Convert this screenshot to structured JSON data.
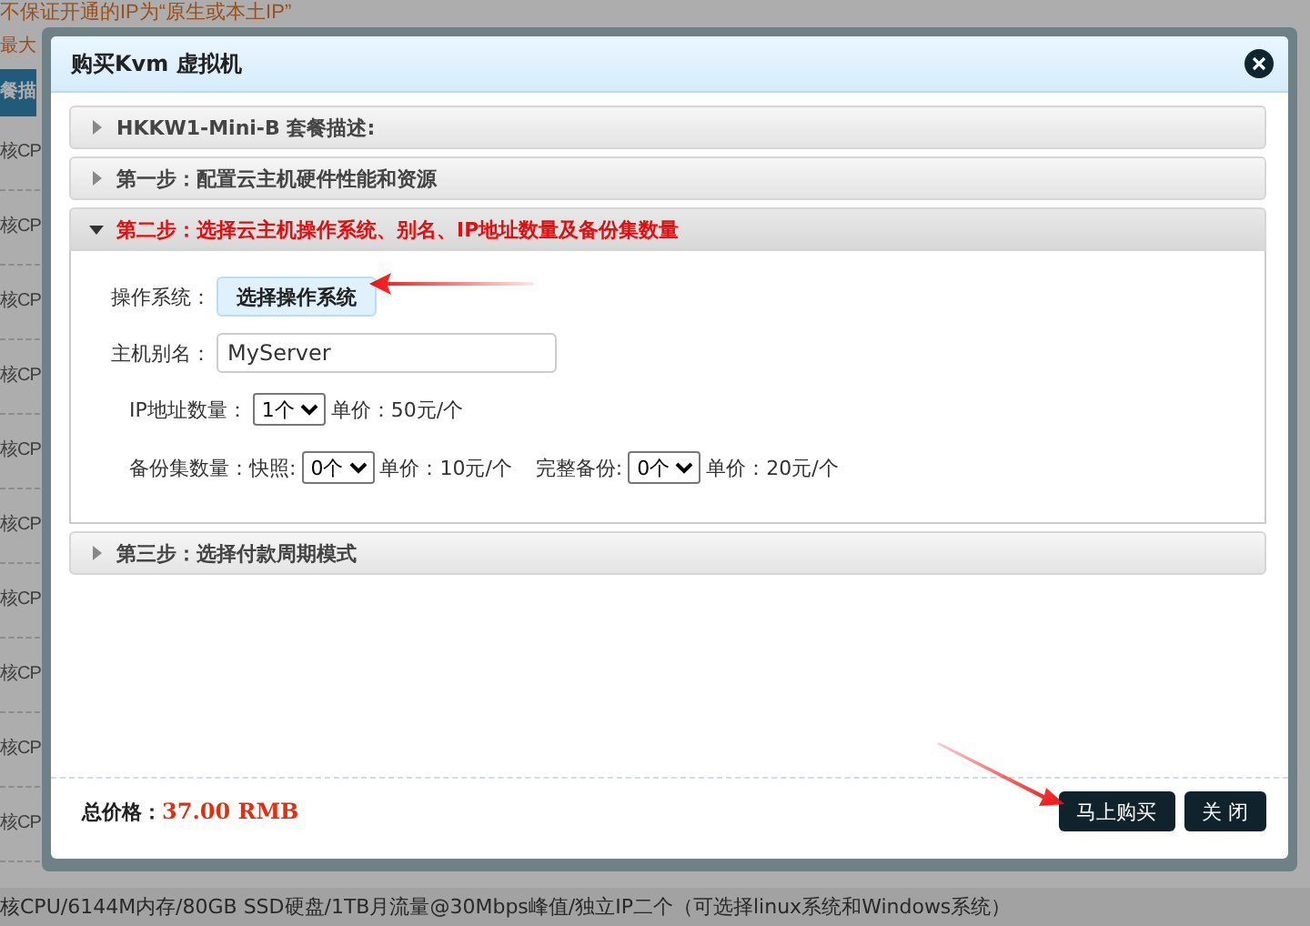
{
  "background": {
    "notes": [
      "不保证开通的IP为“原生或本土IP”",
      "最大"
    ],
    "header_cell": "餐描",
    "rows": [
      "核CP",
      "核CP",
      "核CP",
      "核CP",
      "核CP",
      "核CP",
      "核CP",
      "核CP",
      "核CP",
      "核CP"
    ],
    "footer": "核CPU/6144M内存/80GB SSD硬盘/1TB月流量@30Mbps峰值/独立IP二个（可选择linux系统和Windows系统）"
  },
  "dialog": {
    "title": "购买Kvm 虚拟机",
    "sections": [
      {
        "title": "HKKW1-Mini-B 套餐描述:",
        "expanded": false
      },
      {
        "title": "第一步：配置云主机硬件性能和资源",
        "expanded": false
      },
      {
        "title": "第二步：选择云主机操作系统、别名、IP地址数量及备份集数量",
        "expanded": true
      },
      {
        "title": "第三步：选择付款周期模式",
        "expanded": false
      }
    ],
    "form": {
      "os_label": "操作系统：",
      "os_button": "选择操作系统",
      "alias_label": "主机别名：",
      "alias_value": "MyServer",
      "ip_label": "IP地址数量：",
      "ip_value": "1个",
      "ip_price": "单价：50元/个",
      "backup_label": "备份集数量：快照:",
      "snapshot_value": "0个",
      "snapshot_price": "单价：10元/个",
      "full_label": "完整备份:",
      "full_value": "0个",
      "full_price": "单价：20元/个"
    },
    "total_label": "总价格：",
    "total_value": "37.00 RMB",
    "buttons": [
      "马上购买",
      "关 闭"
    ]
  }
}
